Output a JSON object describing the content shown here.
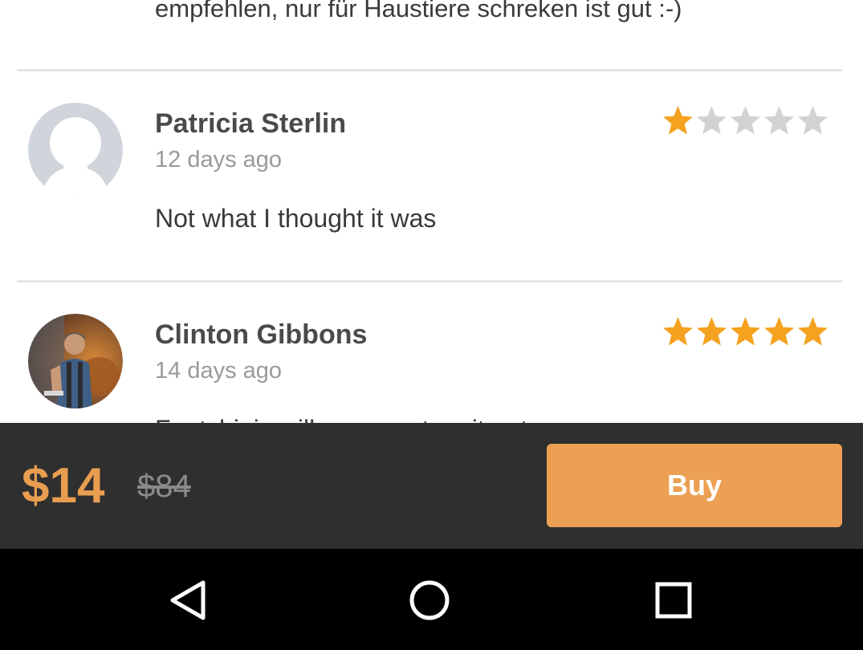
{
  "previous_review": {
    "text": "empfehlen, nur für Haustiere schreken ist gut :-)"
  },
  "reviews": [
    {
      "name": "Patricia Sterlin",
      "date": "12 days ago",
      "text": "Not what I thought it was",
      "rating": 1,
      "max_rating": 5,
      "avatar": "default-avatar-silhouette"
    },
    {
      "name": "Clinton Gibbons",
      "date": "14 days ago",
      "text": "Fantchinis will ... a... ... to ...it ... t",
      "rating": 5,
      "max_rating": 5,
      "avatar": "photo-avatar"
    }
  ],
  "purchase": {
    "price": "$14",
    "original_price": "$84",
    "buy_label": "Buy"
  },
  "nav": {
    "back_icon": "back-triangle-icon",
    "home_icon": "home-circle-icon",
    "recents_icon": "recents-square-icon"
  },
  "colors": {
    "accent": "#eba054",
    "star_filled": "#f4a21f",
    "star_empty": "#d2d2d2",
    "bar_background": "#2f2f2f"
  }
}
